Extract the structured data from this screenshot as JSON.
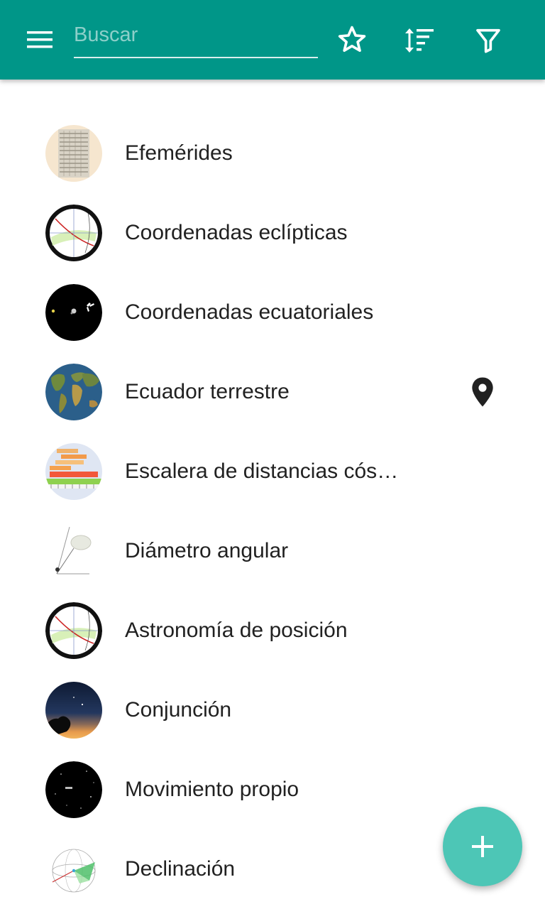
{
  "colors": {
    "appbar": "#009688",
    "fab": "#4dc6b6",
    "text": "#212121"
  },
  "appbar": {
    "menu_icon": "menu-icon",
    "search": {
      "placeholder": "Buscar",
      "value": ""
    },
    "actions": [
      "star-outline-icon",
      "sort-icon",
      "filter-icon"
    ]
  },
  "items": [
    {
      "label": "Efemérides",
      "thumb": "ephemeris-table"
    },
    {
      "label": "Coordenadas eclípticas",
      "thumb": "celestial-sphere"
    },
    {
      "label": "Coordenadas ecuatoriales",
      "thumb": "starfield"
    },
    {
      "label": "Ecuador terrestre",
      "thumb": "world-map",
      "badge": "location-pin-icon"
    },
    {
      "label": "Escalera de distancias cósmicas",
      "thumb": "distance-ladder"
    },
    {
      "label": "Diámetro angular",
      "thumb": "angular-diameter"
    },
    {
      "label": "Astronomía de posición",
      "thumb": "celestial-sphere"
    },
    {
      "label": "Conjunción",
      "thumb": "twilight-sky"
    },
    {
      "label": "Movimiento propio",
      "thumb": "starfield"
    },
    {
      "label": "Declinación",
      "thumb": "declination-sphere"
    }
  ],
  "fab": {
    "icon": "plus-icon"
  }
}
